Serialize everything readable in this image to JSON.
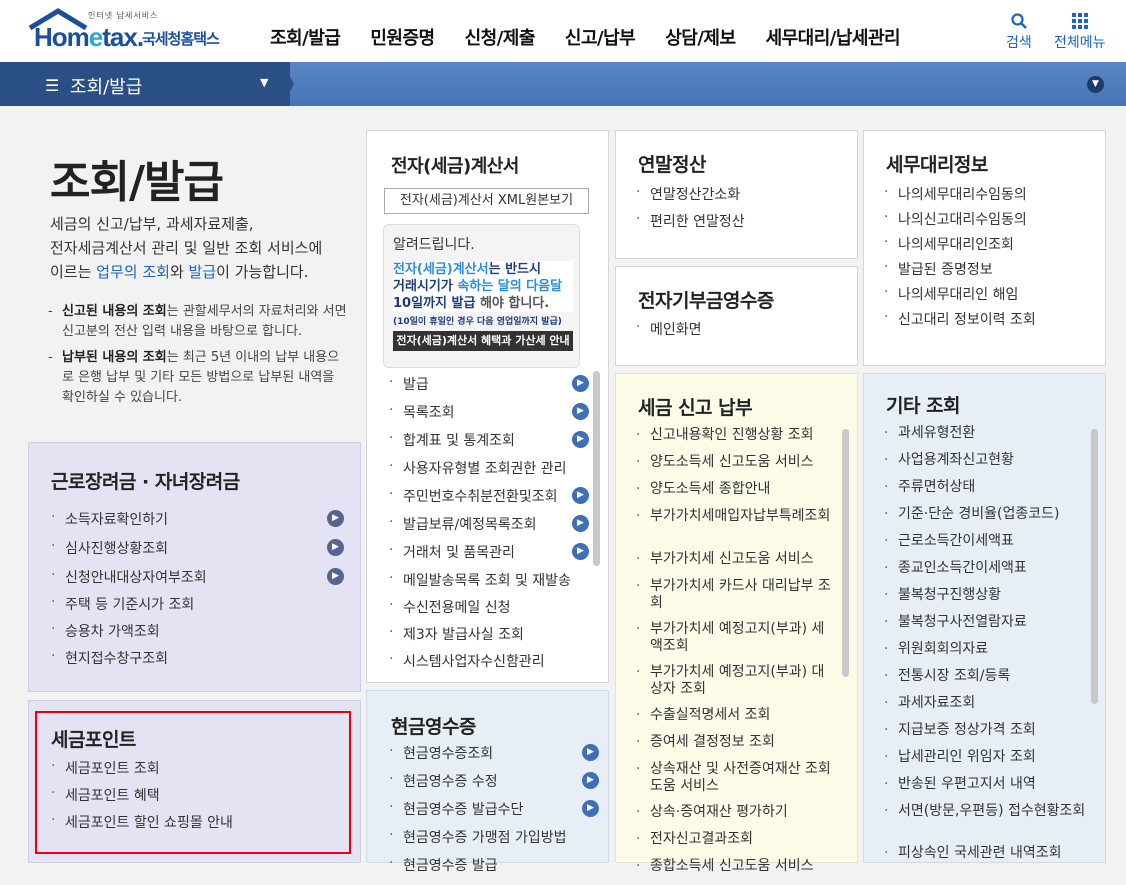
{
  "header": {
    "logo_small": "인터넷 납세서비스",
    "logo_word_a": "Hom",
    "logo_word_e": "e",
    "logo_word_b": "tax.",
    "logo_korean": "국세청홈택스",
    "nav": [
      "조회/발급",
      "민원증명",
      "신청/제출",
      "신고/납부",
      "상담/제보",
      "세무대리/납세관리"
    ],
    "search_label": "검색",
    "allmenu_label": "전체메뉴"
  },
  "subbar": {
    "title": "조회/발급"
  },
  "intro": {
    "title": "조회/발급",
    "desc_a": "세금의 신고/납부, 과세자료제출,",
    "desc_b": "전자세금계산서 관리 및 일반 조회 서비스에",
    "desc_c_pre": "이르는 ",
    "desc_c_link1": "업무의 조회",
    "desc_c_mid": "와 ",
    "desc_c_link2": "발급",
    "desc_c_post": "이 가능합니다.",
    "note1_bold": "신고된 내용의 조회",
    "note1_rest": "는 관할세무서의 자료처리와 서면신고분의 전산 입력 내용을 바탕으로 합니다.",
    "note2_bold": "납부된 내용의 조회",
    "note2_rest": "는 최근 5년 이내의 납부 내용으로 은행 납부 및 기타 모든 방법으로 납부된 내역을 확인하실 수 있습니다."
  },
  "labor": {
    "title": "근로장려금 · 자녀장려금",
    "items": [
      "소득자료확인하기",
      "심사진행상황조회",
      "신청안내대상자여부조회",
      "주택 등 기준시가 조회",
      "승용차 가액조회",
      "현지접수창구조회"
    ]
  },
  "taxpoint": {
    "title": "세금포인트",
    "items": [
      "세금포인트 조회",
      "세금포인트 혜택",
      "세금포인트 할인 쇼핑몰 안내"
    ]
  },
  "einvoice": {
    "title": "전자(세금)계산서",
    "xml_button": "전자(세금)계산서 XML원본보기",
    "notice_title": "알려드립니다.",
    "notice_a1": "전자(세금)계산서",
    "notice_a2": "는 반드시",
    "notice_b1": "거래시기가 ",
    "notice_b2": "속하는 달의 다음달",
    "notice_c1": "10일까지 발급",
    "notice_c2": " 해야 합니다.",
    "notice_small": "(10일이 휴일인 경우 다음 영업일까지 발급)",
    "notice_button": "전자(세금)계산서 혜택과 가산세 안내",
    "items": [
      "발급",
      "목록조회",
      "합계표 및 통계조회",
      "사용자유형별 조회권한 관리",
      "주민번호수취분전환및조회",
      "발급보류/예정목록조회",
      "거래처 및 품목관리",
      "메일발송목록 조회 및 재발송",
      "수신전용메일 신청",
      "제3자 발급사실 조회",
      "시스템사업자수신함관리"
    ]
  },
  "cashreceipt": {
    "title": "현금영수증",
    "items": [
      "현금영수증조회",
      "현금영수증 수정",
      "현금영수증 발급수단",
      "현금영수증 가맹점 가입방법",
      "현금영수증 발급"
    ]
  },
  "yearend": {
    "title": "연말정산",
    "items": [
      "연말정산간소화",
      "편리한 연말정산"
    ]
  },
  "donation": {
    "title": "전자기부금영수증",
    "items": [
      "메인화면"
    ]
  },
  "taxfiling": {
    "title": "세금 신고 납부",
    "items": [
      "신고내용확인 진행상황 조회",
      "양도소득세 신고도움 서비스",
      "양도소득세 종합안내",
      "부가가치세매입자납부특례조회",
      "부가가치세 신고도움 서비스",
      "부가가치세 카드사 대리납부 조회",
      "부가가치세 예정고지(부과) 세액조회",
      "부가가치세 예정고지(부과) 대상자 조회",
      "수출실적명세서 조회",
      "증여세 결정정보 조회",
      "상속재산 및 사전증여재산 조회 도움 서비스",
      "상속·증여재산 평가하기",
      "전자신고결과조회",
      "종합소득세 신고도움 서비스"
    ]
  },
  "agent": {
    "title": "세무대리정보",
    "items": [
      "나의세무대리수임동의",
      "나의신고대리수임동의",
      "나의세무대리인조회",
      "발급된 증명정보",
      "나의세무대리인 해임",
      "신고대리 정보이력 조회"
    ]
  },
  "etc": {
    "title": "기타 조회",
    "items": [
      "과세유형전환",
      "사업용계좌신고현황",
      "주류면허상태",
      "기준·단순 경비율(업종코드)",
      "근로소득간이세액표",
      "종교인소득간이세액표",
      "불복청구진행상황",
      "불복청구사전열람자료",
      "위원회회의자료",
      "전통시장 조회/등록",
      "과세자료조회",
      "지급보증 정상가격 조회",
      "납세관리인 위임자 조회",
      "반송된 우편고지서 내역",
      "서면(방문,우편등) 접수현황조회",
      "피상속인 국세관련 내역조회"
    ]
  }
}
